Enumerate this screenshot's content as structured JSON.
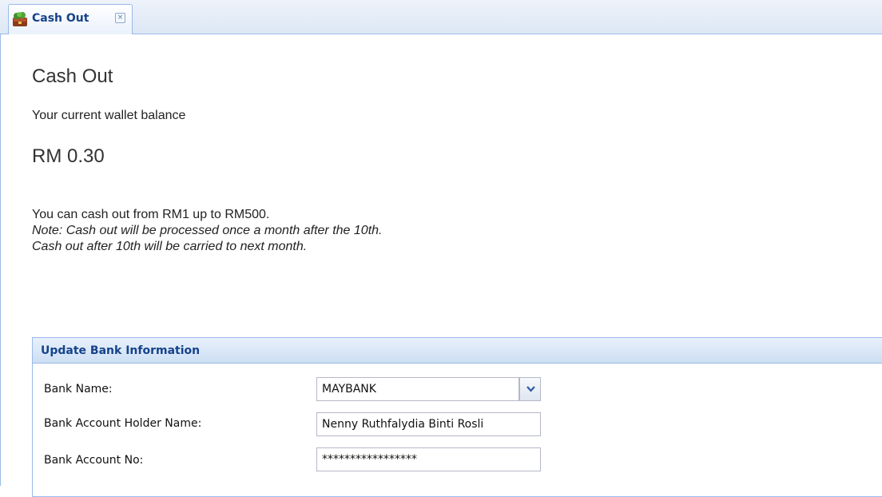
{
  "tab": {
    "label": "Cash Out",
    "icon": "money-bag-icon",
    "close_icon": "close-icon",
    "close_glyph": "×"
  },
  "page": {
    "title": "Cash Out",
    "balance_label": "Your current wallet balance",
    "balance_value": "RM 0.30",
    "info": {
      "line1": "You can cash out from RM1 up to RM500.",
      "line2": "Note: Cash out will be processed once a month after the 10th.",
      "line3": "Cash out after 10th will be carried to next month."
    }
  },
  "bank_panel": {
    "title": "Update Bank Information",
    "bank_name_label": "Bank Name:",
    "bank_name_value": "MAYBANK",
    "holder_label": "Bank Account Holder Name:",
    "holder_value": "Nenny Ruthfalydia Binti Rosli",
    "account_no_label": "Bank Account No:",
    "account_no_value": "*****************"
  },
  "colors": {
    "accent": "#15428b",
    "border": "#99bbe8"
  }
}
